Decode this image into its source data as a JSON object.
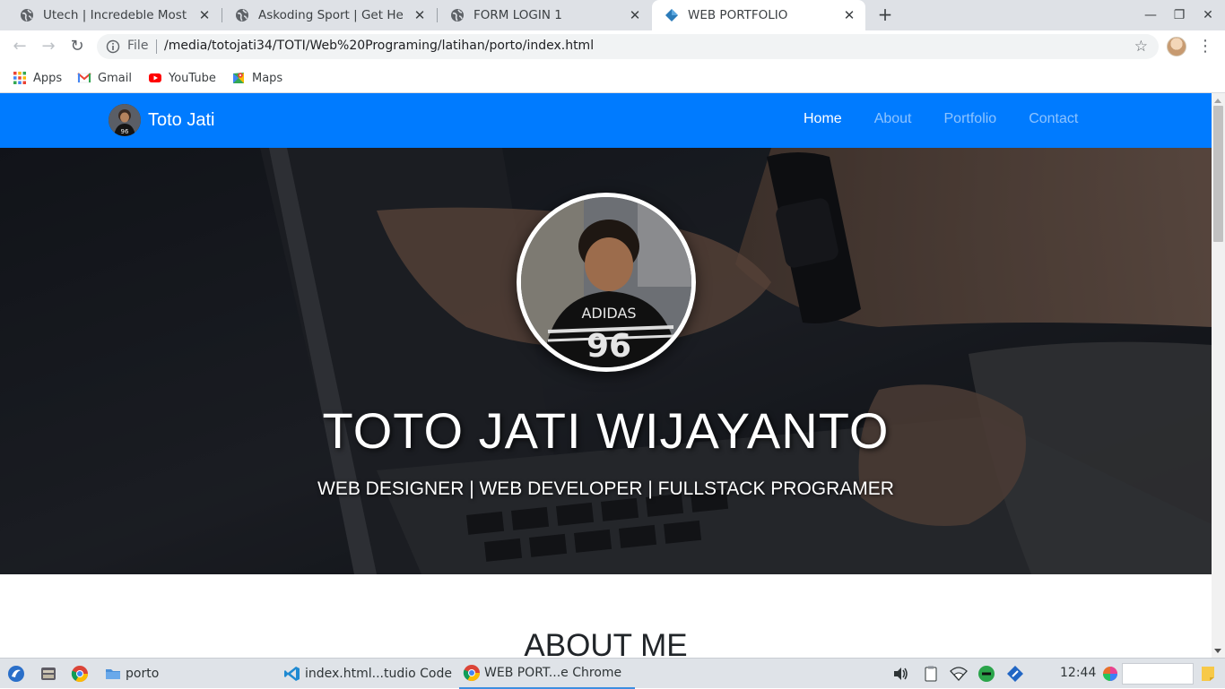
{
  "browser": {
    "tabs": [
      {
        "title": "Utech | Incredeble Most Po",
        "favicon": "globe-icon",
        "active": false
      },
      {
        "title": "Askoding Sport | Get Health",
        "favicon": "globe-icon",
        "active": false
      },
      {
        "title": "FORM LOGIN 1",
        "favicon": "globe-icon",
        "active": false
      },
      {
        "title": "WEB PORTFOLIO",
        "favicon": "diamond-icon",
        "active": true
      }
    ],
    "new_tab": "+",
    "address": {
      "scheme_label": "File",
      "url": "/media/totojati34/TOTI/Web%20Programing/latihan/porto/index.html"
    },
    "bookmarks": [
      {
        "label": "Apps",
        "icon": "apps-grid-icon"
      },
      {
        "label": "Gmail",
        "icon": "gmail-icon"
      },
      {
        "label": "YouTube",
        "icon": "youtube-icon"
      },
      {
        "label": "Maps",
        "icon": "maps-icon"
      }
    ]
  },
  "site": {
    "brand": "Toto Jati",
    "nav": [
      {
        "label": "Home",
        "active": true
      },
      {
        "label": "About",
        "active": false
      },
      {
        "label": "Portfolio",
        "active": false
      },
      {
        "label": "Contact",
        "active": false
      }
    ],
    "hero": {
      "name": "TOTO JATI WIJAYANTO",
      "tagline": "WEB DESIGNER | WEB DEVELOPER | FULLSTACK PROGRAMER"
    },
    "about_heading": "ABOUT ME",
    "colors": {
      "navbar": "#007bff",
      "hero_overlay": "#1a1e26"
    }
  },
  "taskbar": {
    "items": [
      {
        "label": "porto",
        "icon": "folder-icon"
      },
      {
        "label": "index.html...tudio Code",
        "icon": "vscode-icon"
      },
      {
        "label": "WEB PORT...e Chrome",
        "icon": "chrome-icon"
      }
    ],
    "clock": "12:44"
  }
}
